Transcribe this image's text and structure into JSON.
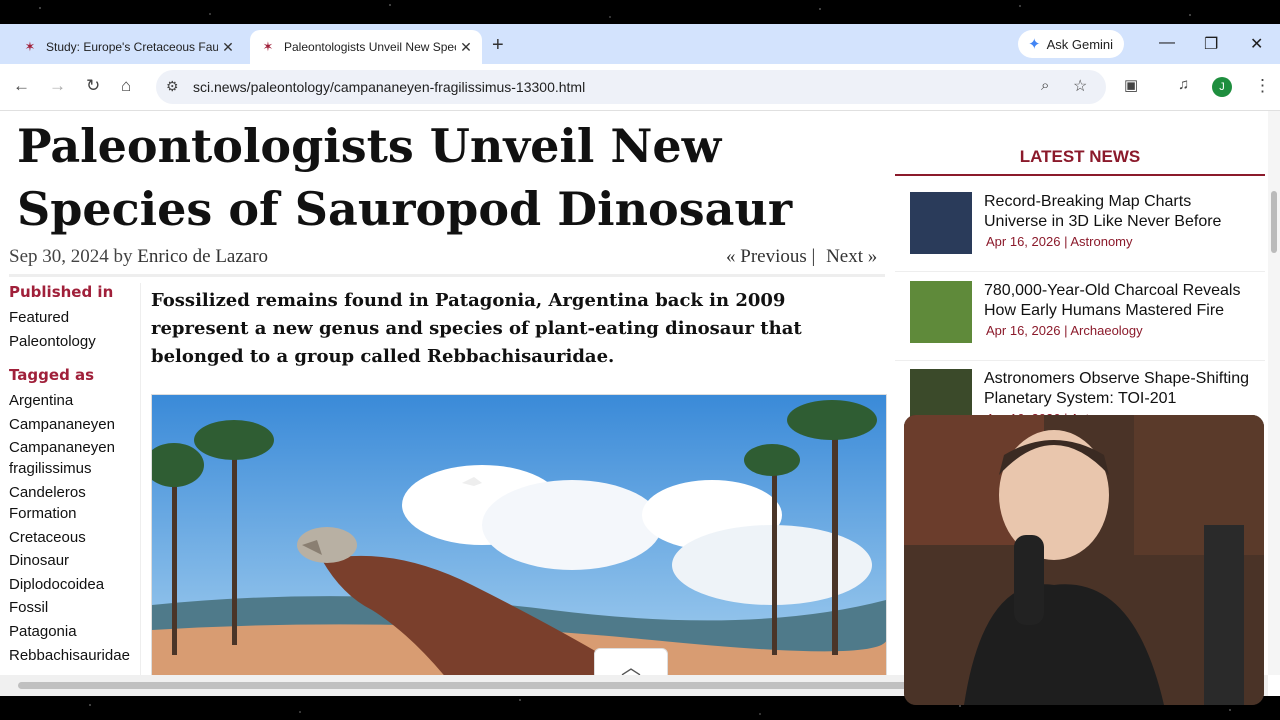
{
  "tabs": [
    {
      "title": "Study: Europe's Cretaceous Fauna",
      "close": "✕"
    },
    {
      "title": "Paleontologists Unveil New Species",
      "close": "✕"
    }
  ],
  "new_tab": "+",
  "gemini": {
    "label": "Ask Gemini"
  },
  "window_controls": {
    "minimize": "—",
    "restore": "❐",
    "close": "✕"
  },
  "nav": {
    "back": "←",
    "forward": "→",
    "reload": "↻",
    "home": "⌂"
  },
  "address": {
    "url": "sci.news/paleontology/campananeyen-fragilissimus-13300.html"
  },
  "profile_initial": "J",
  "article": {
    "headline": "Paleontologists Unveil New Species of Sauropod Dinosaur",
    "date": "Sep 30, 2024",
    "by": "by",
    "author": "Enrico de Lazaro",
    "prev": "« Previous",
    "sep": "|",
    "next": "Next »",
    "lede": "Fossilized remains found in Patagonia, Argentina back in 2009 represent a new genus and species of plant-eating dinosaur that belonged to a group called Rebbachisauridae."
  },
  "sidebar": {
    "published_heading": "Published in",
    "published": [
      "Featured",
      "Paleontology"
    ],
    "tagged_heading": "Tagged as",
    "tags": [
      "Argentina",
      "Campananeyen",
      "Campananeyen fragilissimus",
      "Candeleros Formation",
      "Cretaceous",
      "Dinosaur",
      "Diplodocoidea",
      "Fossil",
      "Patagonia",
      "Rebbachisauridae"
    ]
  },
  "latest": {
    "heading": "LATEST NEWS",
    "items": [
      {
        "title": "Record-Breaking Map Charts Universe in 3D Like Never Before",
        "date": "Apr 16, 2026",
        "sep": "|",
        "category": "Astronomy"
      },
      {
        "title": "780,000-Year-Old Charcoal Reveals How Early Humans Mastered Fire",
        "date": "Apr 16, 2026",
        "sep": "|",
        "category": "Archaeology"
      },
      {
        "title": "Astronomers Observe Shape-Shifting Planetary System: TOI-201",
        "date": "Apr 16, 2026",
        "sep": "|",
        "category": "Astronomy"
      }
    ]
  },
  "colors": {
    "accent": "#a0203a",
    "tabbar": "#d3e3fd",
    "omnibox": "#eef1f8"
  }
}
